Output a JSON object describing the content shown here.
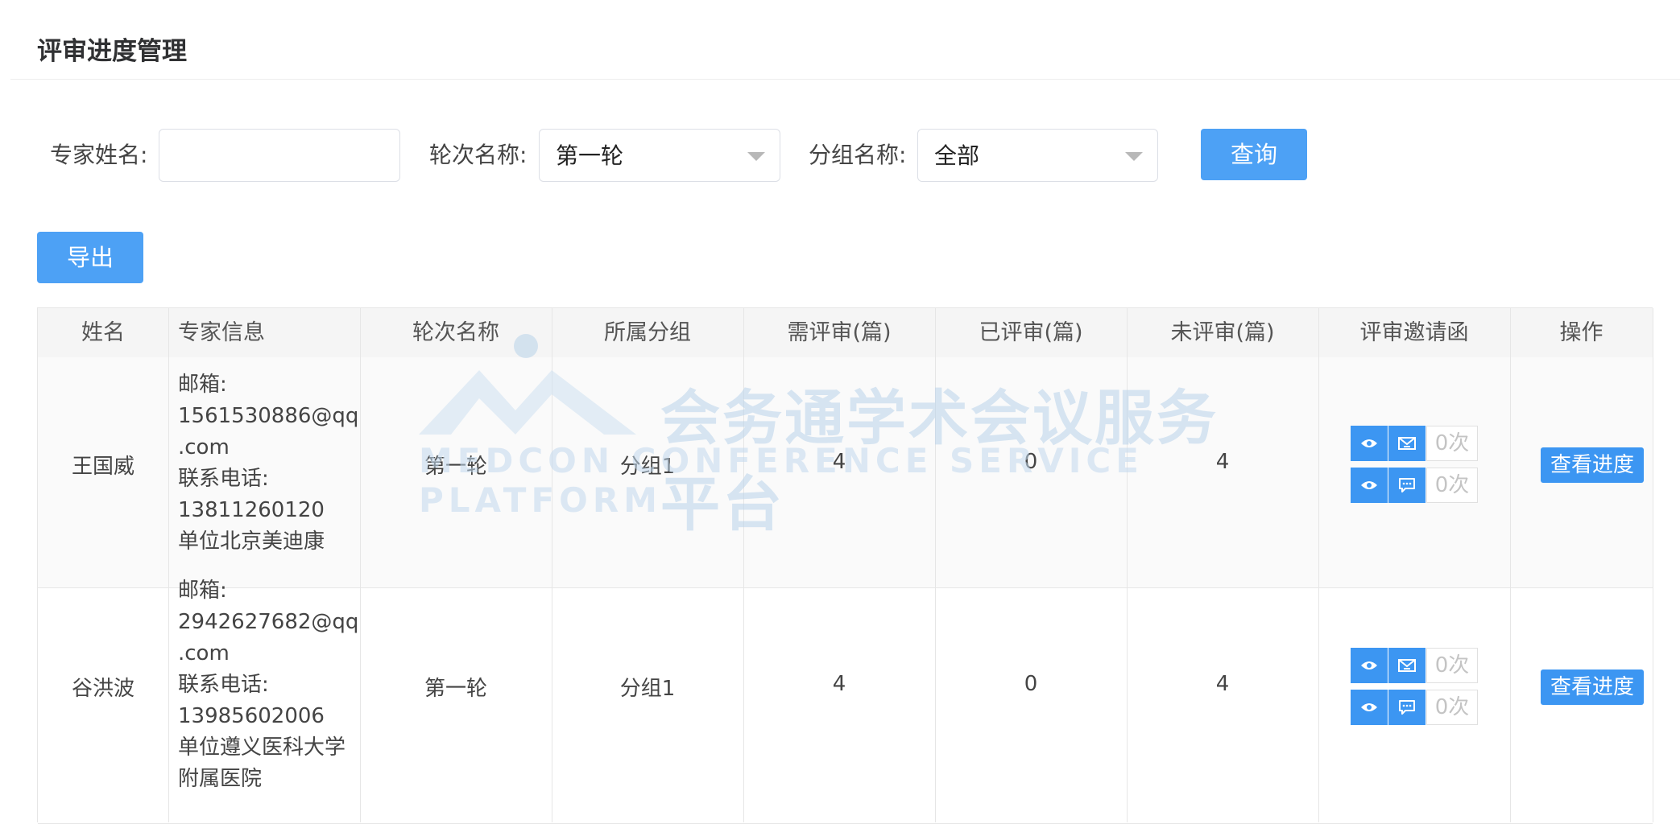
{
  "page": {
    "title": "评审进度管理"
  },
  "filters": {
    "expert_label": "专家姓名:",
    "expert_value": "",
    "round_label": "轮次名称:",
    "round_value": "第一轮",
    "group_label": "分组名称:",
    "group_value": "全部",
    "query_label": "查询"
  },
  "toolbar": {
    "export_label": "导出"
  },
  "table": {
    "headers": [
      "姓名",
      "专家信息",
      "轮次名称",
      "所属分组",
      "需评审(篇)",
      "已评审(篇)",
      "未评审(篇)",
      "评审邀请函",
      "操作"
    ],
    "rows": [
      {
        "name": "王国威",
        "info": [
          "邮箱:",
          "1561530886@qq",
          ".com",
          "联系电话:",
          "13811260120",
          "单位北京美迪康"
        ],
        "round": "第一轮",
        "group": "分组1",
        "required": "4",
        "reviewed": "0",
        "pending": "4",
        "email_count": "0次",
        "sms_count": "0次",
        "action_label": "查看进度"
      },
      {
        "name": "谷洪波",
        "info": [
          "邮箱:",
          "2942627682@qq",
          ".com",
          "联系电话:",
          "13985602006",
          "单位遵义医科大学",
          "附属医院"
        ],
        "round": "第一轮",
        "group": "分组1",
        "required": "4",
        "reviewed": "0",
        "pending": "4",
        "email_count": "0次",
        "sms_count": "0次",
        "action_label": "查看进度"
      }
    ]
  },
  "watermark": {
    "text_cn": "会务通学术会议服务平台",
    "text_en": "MEDCON CONFERENCE SERVICE PLATFORM",
    "logo_text": "MEDCON"
  },
  "colors": {
    "primary": "#4da1f5",
    "icon_button": "#3c96f2",
    "watermark": "#b9d3ea"
  },
  "icons": [
    "eye-icon",
    "envelope-icon",
    "chat-bubble-icon",
    "chevron-down-icon"
  ]
}
